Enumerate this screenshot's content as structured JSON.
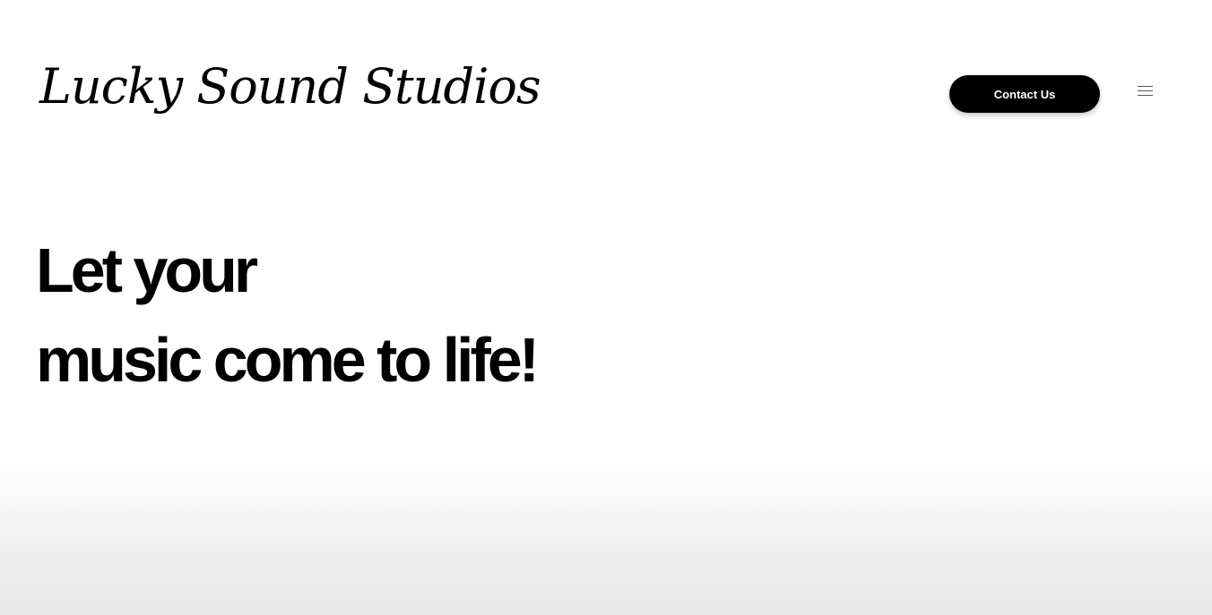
{
  "header": {
    "logo_text": "Lucky Sound Studios",
    "contact_button_label": "Contact Us",
    "menu_icon": "hamburger-menu-icon"
  },
  "hero": {
    "line1": "Let your",
    "line2": "music come to life!"
  },
  "colors": {
    "text": "#000000",
    "button_background": "#000000",
    "button_text": "#ffffff",
    "background": "#ffffff",
    "bottom_gradient": "#e8e8e8"
  }
}
